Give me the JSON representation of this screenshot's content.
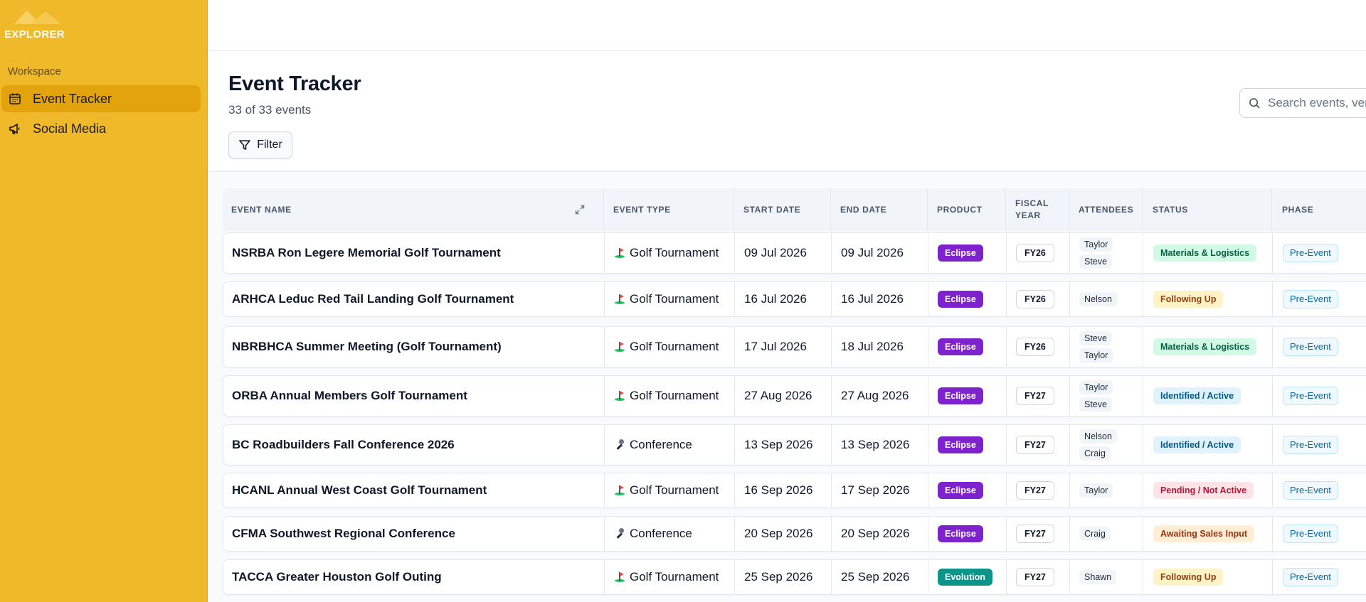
{
  "app": {
    "logo_text": "EXPLORER",
    "workspace_label": "Workspace"
  },
  "sidebar": {
    "items": [
      {
        "label": "Event Tracker",
        "icon": "calendar-icon",
        "active": true
      },
      {
        "label": "Social Media",
        "icon": "megaphone-icon",
        "active": false
      }
    ]
  },
  "header": {
    "title": "Event Tracker",
    "subtitle": "33 of 33 events",
    "filter_label": "Filter",
    "search_placeholder": "Search events, venues..."
  },
  "table": {
    "columns": [
      "Event Name",
      "Event Type",
      "Start Date",
      "End Date",
      "Product",
      "Fiscal Year",
      "Attendees",
      "Status",
      "Phase"
    ],
    "rows": [
      {
        "name": "NSRBA Ron Legere Memorial Golf Tournament",
        "type": "Golf Tournament",
        "type_icon": "golf-flag-icon",
        "start": "09 Jul 2026",
        "end": "09 Jul 2026",
        "product": "Eclipse",
        "fy": "FY26",
        "attendees": [
          "Taylor",
          "Steve"
        ],
        "status": "Materials & Logistics",
        "phase": "Pre-Event"
      },
      {
        "name": "ARHCA Leduc Red Tail Landing Golf Tournament",
        "type": "Golf Tournament",
        "type_icon": "golf-flag-icon",
        "start": "16 Jul 2026",
        "end": "16 Jul 2026",
        "product": "Eclipse",
        "fy": "FY26",
        "attendees": [
          "Nelson"
        ],
        "status": "Following Up",
        "phase": "Pre-Event"
      },
      {
        "name": "NBRBHCA Summer Meeting (Golf Tournament)",
        "type": "Golf Tournament",
        "type_icon": "golf-flag-icon",
        "start": "17 Jul 2026",
        "end": "18 Jul 2026",
        "product": "Eclipse",
        "fy": "FY26",
        "attendees": [
          "Steve",
          "Taylor"
        ],
        "status": "Materials & Logistics",
        "phase": "Pre-Event"
      },
      {
        "name": "ORBA Annual Members Golf Tournament",
        "type": "Golf Tournament",
        "type_icon": "golf-flag-icon",
        "start": "27 Aug 2026",
        "end": "27 Aug 2026",
        "product": "Eclipse",
        "fy": "FY27",
        "attendees": [
          "Taylor",
          "Steve"
        ],
        "status": "Identified / Active",
        "phase": "Pre-Event"
      },
      {
        "name": "BC Roadbuilders Fall Conference 2026",
        "type": "Conference",
        "type_icon": "microphone-icon",
        "start": "13 Sep 2026",
        "end": "13 Sep 2026",
        "product": "Eclipse",
        "fy": "FY27",
        "attendees": [
          "Nelson",
          "Craig"
        ],
        "status": "Identified / Active",
        "phase": "Pre-Event"
      },
      {
        "name": "HCANL Annual West Coast Golf Tournament",
        "type": "Golf Tournament",
        "type_icon": "golf-flag-icon",
        "start": "16 Sep 2026",
        "end": "17 Sep 2026",
        "product": "Eclipse",
        "fy": "FY27",
        "attendees": [
          "Taylor"
        ],
        "status": "Pending / Not Active",
        "phase": "Pre-Event"
      },
      {
        "name": "CFMA Southwest Regional Conference",
        "type": "Conference",
        "type_icon": "microphone-icon",
        "start": "20 Sep 2026",
        "end": "20 Sep 2026",
        "product": "Eclipse",
        "fy": "FY27",
        "attendees": [
          "Craig"
        ],
        "status": "Awaiting Sales Input",
        "phase": "Pre-Event"
      },
      {
        "name": "TACCA Greater Houston Golf Outing",
        "type": "Golf Tournament",
        "type_icon": "golf-flag-icon",
        "start": "25 Sep 2026",
        "end": "25 Sep 2026",
        "product": "Evolution",
        "fy": "FY27",
        "attendees": [
          "Shawn"
        ],
        "status": "Following Up",
        "phase": "Pre-Event"
      }
    ]
  },
  "colors": {
    "sidebar_bg": "#f0b929",
    "sidebar_active": "#e3a30c",
    "product_eclipse": "#7e22ce",
    "product_evolution": "#0d9488",
    "status": {
      "Materials & Logistics": {
        "bg": "#d1fae5",
        "fg": "#065f46"
      },
      "Following Up": {
        "bg": "#fef3c7",
        "fg": "#92400e"
      },
      "Identified / Active": {
        "bg": "#e0f2fe",
        "fg": "#075985"
      },
      "Pending / Not Active": {
        "bg": "#ffe4e6",
        "fg": "#be123c"
      },
      "Awaiting Sales Input": {
        "bg": "#ffedd5",
        "fg": "#9a3412"
      }
    }
  }
}
